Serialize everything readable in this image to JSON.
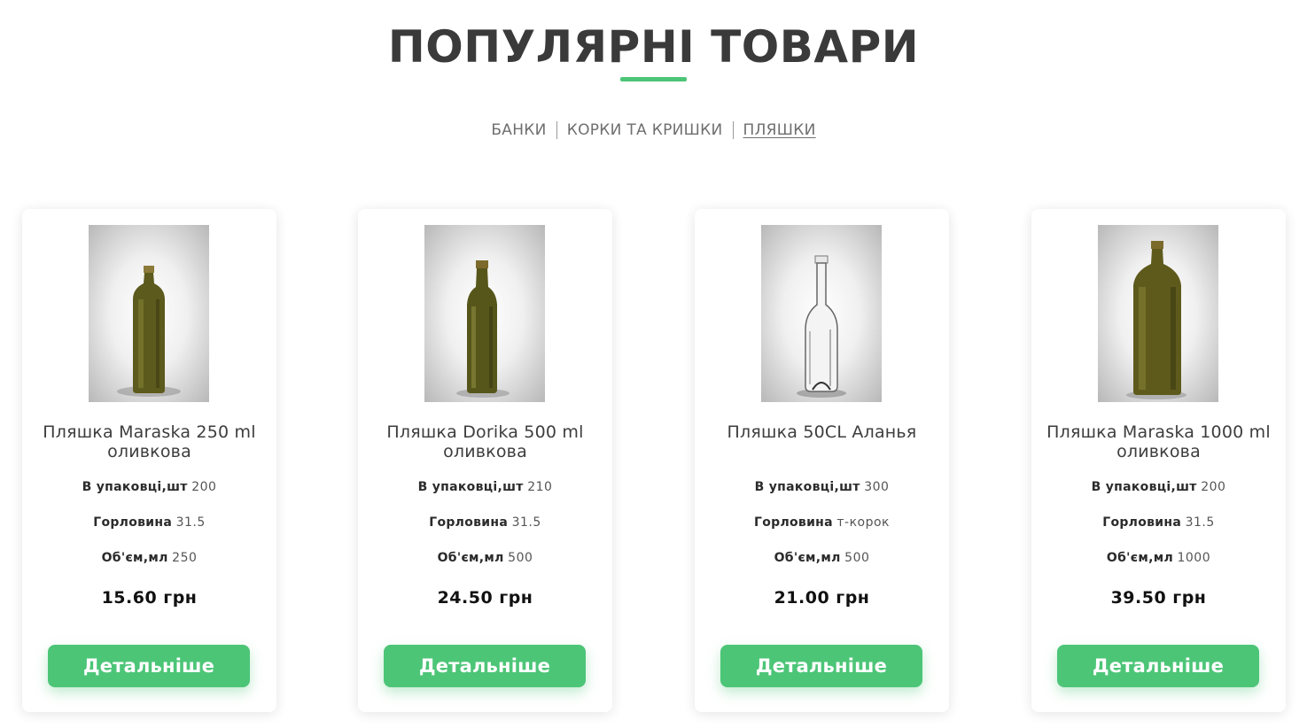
{
  "section": {
    "title": "ПОПУЛЯРНІ ТОВАРИ",
    "accent_color": "#4cc577"
  },
  "tabs": [
    {
      "label": "БАНКИ",
      "active": false
    },
    {
      "label": "КОРКИ ТА КРИШКИ",
      "active": false
    },
    {
      "label": "ПЛЯШКИ",
      "active": true
    }
  ],
  "spec_labels": {
    "per_pack": "В упаковці,шт",
    "neck": "Горловина",
    "volume": "Об'єм,мл"
  },
  "products": [
    {
      "name": "Пляшка Maraska 250 ml оливкова",
      "per_pack": "200",
      "neck": "31.5",
      "volume": "250",
      "price": "15.60 грн",
      "button": "Детальніше",
      "image_icon": "olive-bottle-square-small-image"
    },
    {
      "name": "Пляшка Dorika 500 ml оливкова",
      "per_pack": "210",
      "neck": "31.5",
      "volume": "500",
      "price": "24.50 грн",
      "button": "Детальніше",
      "image_icon": "olive-bottle-round-image"
    },
    {
      "name": "Пляшка 50CL Аланья",
      "per_pack": "300",
      "neck": "т-корок",
      "volume": "500",
      "price": "21.00 грн",
      "button": "Детальніше",
      "image_icon": "clear-bottle-image"
    },
    {
      "name": "Пляшка Maraska 1000 ml оливкова",
      "per_pack": "200",
      "neck": "31.5",
      "volume": "1000",
      "price": "39.50 грн",
      "button": "Детальніше",
      "image_icon": "olive-bottle-square-large-image"
    }
  ]
}
